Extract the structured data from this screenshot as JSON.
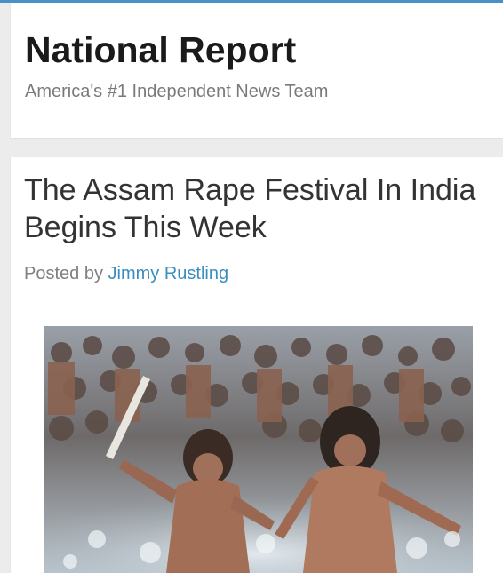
{
  "header": {
    "site_title": "National Report",
    "tagline": "America's #1 Independent News Team"
  },
  "article": {
    "title": "The Assam Rape Festival In India Begins This Week",
    "byline_prefix": "Posted by",
    "author": "Jimmy Rustling",
    "image": {
      "subject": "crowd-of-men-running-through-water"
    }
  },
  "colors": {
    "accent_rule": "#4a8fc7",
    "link": "#3a8dbf",
    "title_text": "#1a1a1a",
    "muted_text": "#7a7a7a"
  }
}
